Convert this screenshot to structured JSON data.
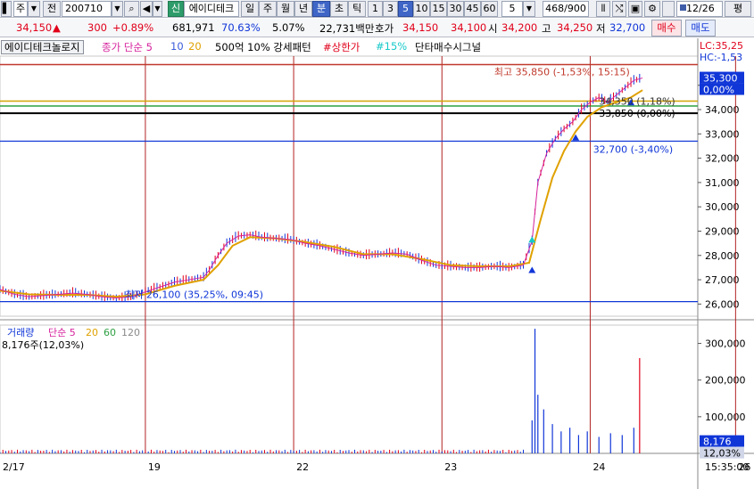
{
  "toolbar": {
    "market_type": "주",
    "prev_label": "전",
    "stock_code": "200710",
    "badge_new": "신",
    "stock_name": "에이디테크",
    "period_day": "일",
    "period_week": "주",
    "period_month": "월",
    "period_year": "년",
    "period_minute": "분",
    "period_second": "초",
    "period_tick": "틱",
    "intervals": [
      "1",
      "3",
      "5",
      "10",
      "15",
      "30",
      "45",
      "60"
    ],
    "selected_interval": "5",
    "interval_value": "5",
    "count_display": "468/900",
    "date_label": "12/26",
    "mode_label": "평"
  },
  "quote": {
    "price": "34,150",
    "change_arrow": "▲",
    "change": "300",
    "change_pct": "+0.89%",
    "volume": "681,971",
    "vol_ratio": "70.63%",
    "turnover_pct": "5.07%",
    "amount": "22,731백만",
    "bid_ask_label": "호가",
    "bid_ask_1": "34,150",
    "bid_ask_2": "34,100",
    "open_label": "시",
    "open": "34,200",
    "high_label": "고",
    "high": "34,250",
    "low_label": "저",
    "low": "32,700",
    "buy_button": "매수",
    "sell_button": "매도"
  },
  "legend": {
    "stock_tag": "에이디테크놀로지",
    "close_ma": "종가 단순 5",
    "ma10": "10",
    "ma20": "20",
    "pattern1": "500억 10% 강세패턴",
    "pattern2": "#상한가",
    "pattern3": "#15%",
    "pattern4": "단타매수시그널",
    "lc": "LC:35,25",
    "hc": "HC:-1,53"
  },
  "annotations": {
    "high_note": "최고 35,850 (-1,53%, 15:15)",
    "low_note": "최저 26,100 (35,25%, 09:45)",
    "level_34350": "34,350 (1,18%)",
    "level_33850": "33,850 (0,00%)",
    "level_32700": "32,700 (-3,40%)",
    "price_box": "35,300",
    "pct_box": "0,00%"
  },
  "volume_panel": {
    "label": "거래량",
    "ma_label": "단순 5",
    "ma20": "20",
    "ma60": "60",
    "ma120": "120",
    "current": "8,176주(12,03%)",
    "current_box": "8,176",
    "pct_box": "12,03%"
  },
  "colors": {
    "up": "#e0001a",
    "down": "#1036d8",
    "ma5": "#d6219c",
    "ma10": "#3a5bd9",
    "ma20": "#e0a100",
    "ma60": "#2ea043",
    "ma120": "#8a8a8a",
    "pattern3": "#17c9c9",
    "line_34350": "#d3a400"
  },
  "chart_data": {
    "type": "candlestick",
    "x_ticks": [
      "2/17",
      "19",
      "22",
      "23",
      "24",
      "26"
    ],
    "time_label": "15:35:00",
    "price_ticks": [
      26000,
      27000,
      28000,
      29000,
      30000,
      31000,
      32000,
      33000,
      34000,
      35000
    ],
    "price_tick_labels": [
      "26,000",
      "27,000",
      "28,000",
      "29,000",
      "30,000",
      "31,000",
      "32,000",
      "33,000",
      "34,000",
      "35,000"
    ],
    "ylim": [
      25500,
      36200
    ],
    "volume_ticks": [
      100000,
      200000,
      300000
    ],
    "volume_tick_labels": [
      "100,000",
      "200,000",
      "300,000"
    ],
    "volume_ylim": [
      0,
      350000
    ],
    "levels": [
      {
        "value": 35850,
        "color": "#c0392b"
      },
      {
        "value": 34350,
        "color": "#d3a400"
      },
      {
        "value": 34150,
        "color": "#2ea043"
      },
      {
        "value": 33850,
        "color": "#000000"
      },
      {
        "value": 32700,
        "color": "#1036d8"
      },
      {
        "value": 26100,
        "color": "#1036d8"
      }
    ],
    "price_path": [
      [
        0,
        26600
      ],
      [
        5,
        26400
      ],
      [
        10,
        26300
      ],
      [
        15,
        26350
      ],
      [
        20,
        26400
      ],
      [
        25,
        26450
      ],
      [
        30,
        26400
      ],
      [
        35,
        26300
      ],
      [
        40,
        26250
      ],
      [
        45,
        26300
      ],
      [
        50,
        26500
      ],
      [
        55,
        26700
      ],
      [
        60,
        26900
      ],
      [
        65,
        27000
      ],
      [
        70,
        27100
      ],
      [
        72,
        27400
      ],
      [
        75,
        28000
      ],
      [
        78,
        28500
      ],
      [
        82,
        28800
      ],
      [
        86,
        28850
      ],
      [
        90,
        28750
      ],
      [
        95,
        28700
      ],
      [
        100,
        28650
      ],
      [
        105,
        28500
      ],
      [
        110,
        28400
      ],
      [
        115,
        28250
      ],
      [
        120,
        28100
      ],
      [
        125,
        28000
      ],
      [
        130,
        28050
      ],
      [
        135,
        28100
      ],
      [
        140,
        28050
      ],
      [
        145,
        27800
      ],
      [
        150,
        27600
      ],
      [
        155,
        27550
      ],
      [
        160,
        27500
      ],
      [
        165,
        27500
      ],
      [
        170,
        27550
      ],
      [
        175,
        27500
      ],
      [
        180,
        27600
      ],
      [
        183,
        28600
      ],
      [
        185,
        31000
      ],
      [
        188,
        32200
      ],
      [
        191,
        32800
      ],
      [
        194,
        33200
      ],
      [
        197,
        33500
      ],
      [
        200,
        34000
      ],
      [
        203,
        34300
      ],
      [
        206,
        34500
      ],
      [
        209,
        34300
      ],
      [
        212,
        34600
      ],
      [
        215,
        34900
      ],
      [
        218,
        35200
      ],
      [
        221,
        35300
      ]
    ],
    "ma20_path": [
      [
        0,
        26550
      ],
      [
        10,
        26400
      ],
      [
        20,
        26380
      ],
      [
        30,
        26380
      ],
      [
        40,
        26300
      ],
      [
        50,
        26400
      ],
      [
        60,
        26750
      ],
      [
        70,
        27000
      ],
      [
        75,
        27600
      ],
      [
        80,
        28400
      ],
      [
        86,
        28750
      ],
      [
        95,
        28700
      ],
      [
        105,
        28550
      ],
      [
        115,
        28350
      ],
      [
        125,
        28050
      ],
      [
        135,
        28050
      ],
      [
        145,
        27850
      ],
      [
        155,
        27600
      ],
      [
        165,
        27550
      ],
      [
        175,
        27550
      ],
      [
        182,
        27700
      ],
      [
        186,
        29500
      ],
      [
        190,
        31200
      ],
      [
        194,
        32300
      ],
      [
        198,
        33100
      ],
      [
        202,
        33700
      ],
      [
        207,
        34100
      ],
      [
        212,
        34300
      ],
      [
        217,
        34500
      ],
      [
        221,
        34800
      ]
    ],
    "volume_spikes": [
      [
        183,
        90000
      ],
      [
        184,
        340000
      ],
      [
        185,
        160000
      ],
      [
        187,
        120000
      ],
      [
        190,
        80000
      ],
      [
        193,
        60000
      ],
      [
        196,
        70000
      ],
      [
        199,
        50000
      ],
      [
        202,
        60000
      ],
      [
        206,
        45000
      ],
      [
        210,
        55000
      ],
      [
        214,
        50000
      ],
      [
        218,
        70000
      ],
      [
        220,
        260000
      ]
    ]
  }
}
